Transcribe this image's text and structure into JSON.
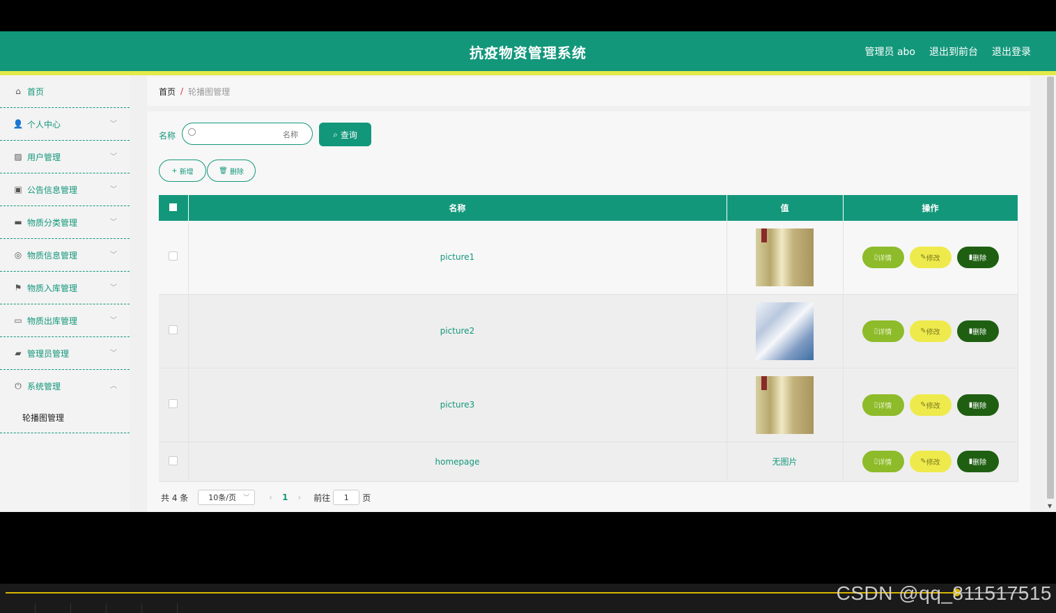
{
  "header": {
    "title": "抗疫物资管理系统",
    "user_label": "管理员 abo",
    "to_front_label": "退出到前台",
    "logout_label": "退出登录"
  },
  "sidebar": {
    "items": [
      {
        "label": "首页",
        "icon": "home-icon"
      },
      {
        "label": "个人中心",
        "icon": "user-icon"
      },
      {
        "label": "用户管理",
        "icon": "chart-icon"
      },
      {
        "label": "公告信息管理",
        "icon": "clipboard-icon"
      },
      {
        "label": "物质分类管理",
        "icon": "briefcase-icon"
      },
      {
        "label": "物质信息管理",
        "icon": "compass-icon"
      },
      {
        "label": "物质入库管理",
        "icon": "flag-icon"
      },
      {
        "label": "物质出库管理",
        "icon": "message-icon"
      },
      {
        "label": "管理员管理",
        "icon": "wallet-icon"
      },
      {
        "label": "系统管理",
        "icon": "power-icon"
      }
    ],
    "submenu_label": "轮播图管理"
  },
  "breadcrumb": {
    "home": "首页",
    "separator": "/",
    "current": "轮播图管理"
  },
  "search": {
    "label": "名称",
    "placeholder": "名称",
    "query_label": "查询"
  },
  "actions": {
    "add_label": "新增",
    "delete_label": "删除"
  },
  "table": {
    "columns": [
      "名称",
      "值",
      "操作"
    ],
    "rows": [
      {
        "name": "picture1",
        "value": "",
        "thumb": "thumb1"
      },
      {
        "name": "picture2",
        "value": "",
        "thumb": "thumb2"
      },
      {
        "name": "picture3",
        "value": "",
        "thumb": "thumb1"
      },
      {
        "name": "homepage",
        "value": "无图片",
        "thumb": ""
      }
    ],
    "op_labels": {
      "detail": "详情",
      "edit": "修改",
      "delete": "删除"
    }
  },
  "pager": {
    "total": "共 4 条",
    "page_size": "10条/页",
    "current_page": "1",
    "goto_label": "前往",
    "goto_value": "1",
    "page_suffix": "页"
  },
  "watermark": "CSDN @qq_811517515",
  "colors": {
    "primary": "#13977b",
    "accent_stripe": "#e3e94a",
    "detail_btn": "#8dbb2a",
    "edit_btn": "#eeea4c",
    "delete_btn": "#1f5f12"
  }
}
